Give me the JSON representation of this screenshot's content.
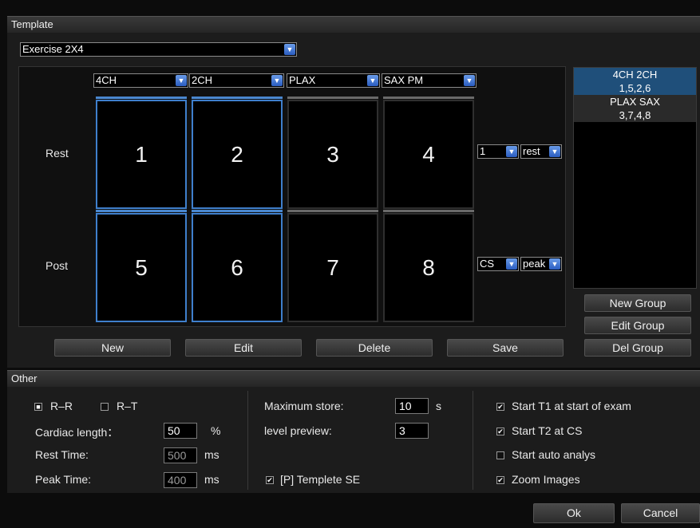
{
  "template": {
    "header": "Template",
    "selected_template": "Exercise 2X4",
    "columns": [
      "4CH",
      "2CH",
      "PLAX",
      "SAX PM"
    ],
    "rows": [
      {
        "label": "Rest",
        "tiles": [
          "1",
          "2",
          "3",
          "4"
        ],
        "stage_value": "1",
        "phase_value": "rest"
      },
      {
        "label": "Post",
        "tiles": [
          "5",
          "6",
          "7",
          "8"
        ],
        "stage_value": "CS",
        "phase_value": "peak"
      }
    ],
    "buttons": {
      "new": "New",
      "edit": "Edit",
      "delete": "Delete",
      "save": "Save"
    }
  },
  "groups": {
    "items": [
      {
        "name": "4CH 2CH",
        "members": "1,5,2,6"
      },
      {
        "name": "PLAX SAX",
        "members": "3,7,4,8"
      }
    ],
    "new_group": "New Group",
    "edit_group": "Edit Group",
    "del_group": "Del Group"
  },
  "other": {
    "header": "Other",
    "rr_label": "R–R",
    "rt_label": "R–T",
    "cardiac_length_label": "Cardiac length：",
    "cardiac_length_value": "50",
    "cardiac_length_unit": "%",
    "rest_time_label": "Rest Time:",
    "rest_time_value": "500",
    "rest_time_unit": "ms",
    "peak_time_label": "Peak Time:",
    "peak_time_value": "400",
    "peak_time_unit": "ms",
    "max_store_label": "Maximum store:",
    "max_store_value": "10",
    "max_store_unit": "s",
    "level_preview_label": "level preview:",
    "level_preview_value": "3",
    "template_se_label": "[P] Templete SE",
    "start_t1_label": "Start T1 at start of exam",
    "start_t2_label": "Start T2 at CS",
    "auto_analys_label": "Start auto analys",
    "zoom_images_label": "Zoom Images"
  },
  "footer": {
    "ok": "Ok",
    "cancel": "Cancel"
  },
  "colors": {
    "accent": "#3f7fcc",
    "selection": "#1f4f7a"
  }
}
